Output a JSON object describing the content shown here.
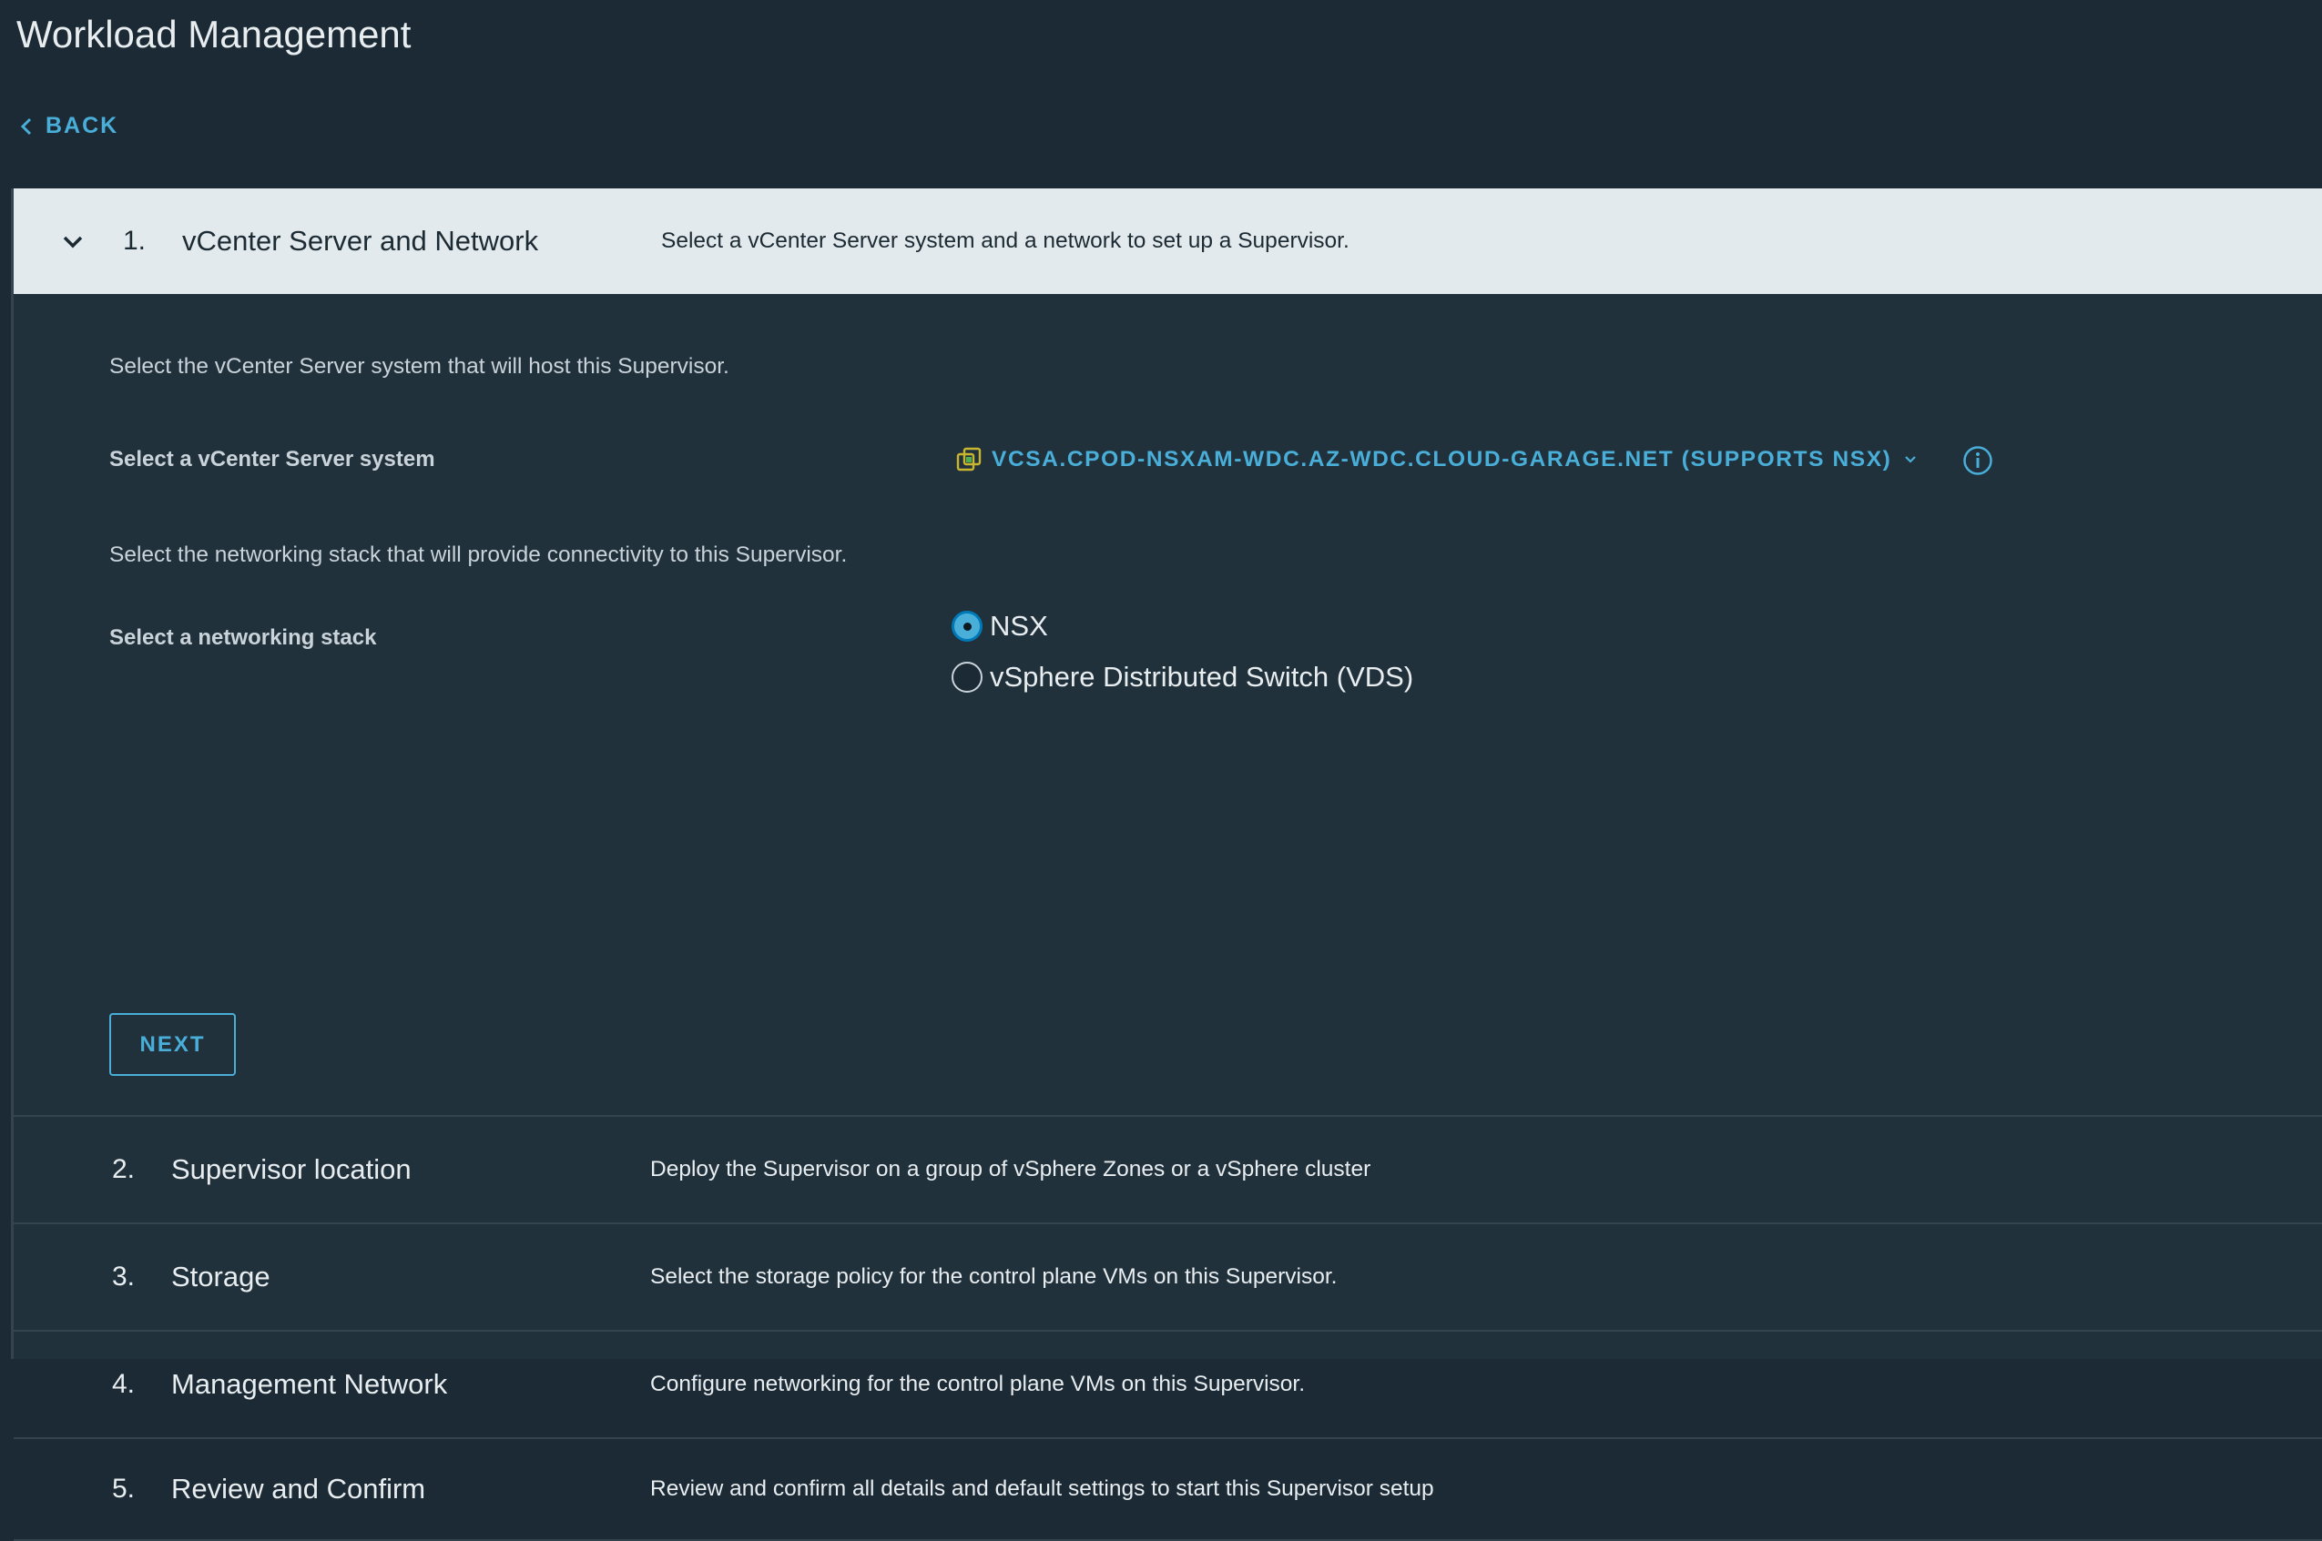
{
  "page": {
    "title": "Workload Management",
    "back_label": "BACK"
  },
  "steps": [
    {
      "number": "1.",
      "title": "vCenter Server and Network",
      "description": "Select a vCenter Server system and a network to set up a Supervisor."
    },
    {
      "number": "2.",
      "title": "Supervisor location",
      "description": "Deploy the Supervisor on a group of vSphere Zones or a vSphere cluster"
    },
    {
      "number": "3.",
      "title": "Storage",
      "description": "Select the storage policy for the control plane VMs on this Supervisor."
    },
    {
      "number": "4.",
      "title": "Management Network",
      "description": "Configure networking for the control plane VMs on this Supervisor."
    },
    {
      "number": "5.",
      "title": "Review and Confirm",
      "description": "Review and confirm all details and default settings to start this Supervisor setup"
    }
  ],
  "step1": {
    "vcenter_intro": "Select the vCenter Server system that will host this Supervisor.",
    "vcenter_label": "Select a vCenter Server system",
    "vcenter_value": "VCSA.CPOD-NSXAM-WDC.AZ-WDC.CLOUD-GARAGE.NET (SUPPORTS NSX)",
    "network_intro": "Select the networking stack that will provide connectivity to this Supervisor.",
    "network_label": "Select a networking stack",
    "network_options": [
      {
        "label": "NSX",
        "selected": true
      },
      {
        "label": "vSphere Distributed Switch (VDS)",
        "selected": false
      }
    ],
    "next_label": "NEXT"
  },
  "colors": {
    "accent": "#49afd9",
    "background": "#1b2a35",
    "panel": "#21313c",
    "active_header": "#e3eaed"
  }
}
